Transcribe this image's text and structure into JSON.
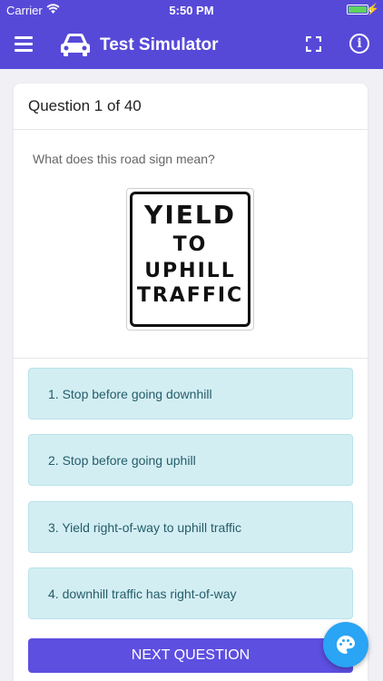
{
  "status_bar": {
    "carrier": "Carrier",
    "time": "5:50 PM",
    "battery_level": 1.0
  },
  "nav": {
    "title": "Test Simulator"
  },
  "question": {
    "header": "Question 1 of 40",
    "text": "What does this road sign mean?",
    "sign_lines": [
      "YIELD",
      "TO",
      "UPHILL",
      "TRAFFIC"
    ]
  },
  "answers": [
    {
      "label": "1. Stop before going downhill"
    },
    {
      "label": "2. Stop before going uphill"
    },
    {
      "label": "3. Yield right-of-way to uphill traffic"
    },
    {
      "label": "4. downhill traffic has right-of-way"
    }
  ],
  "next_button": {
    "label": "NEXT QUESTION"
  },
  "colors": {
    "nav": "#5749d8",
    "answer_bg": "#d3eef3",
    "answer_text": "#255d6a",
    "fab": "#2aa4f4",
    "button": "#5d4fe0"
  },
  "icons": {
    "menu": "hamburger-icon",
    "logo": "car-icon",
    "fullscreen": "fullscreen-icon",
    "info": "info-icon",
    "fab": "palette-icon"
  }
}
